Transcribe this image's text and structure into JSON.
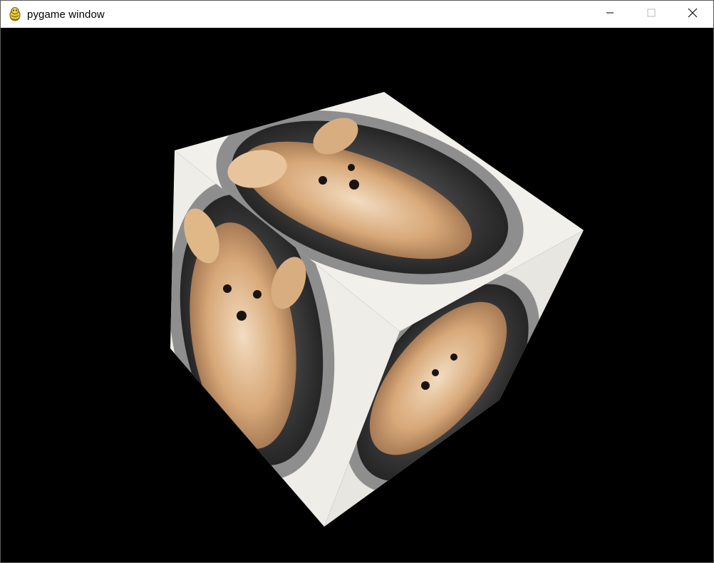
{
  "window": {
    "title": "pygame window",
    "icon": "pygame-snake-icon",
    "controls": {
      "minimize_icon": "minimize-icon",
      "maximize_icon": "maximize-icon",
      "close_icon": "close-icon"
    }
  },
  "scene": {
    "background_color": "#000000",
    "object": "textured-cube",
    "texture_subject": "dog-photo",
    "face_color": "#f2f0ea",
    "ring_color": "#8e8e8e",
    "fur_color": "#d8a878"
  }
}
